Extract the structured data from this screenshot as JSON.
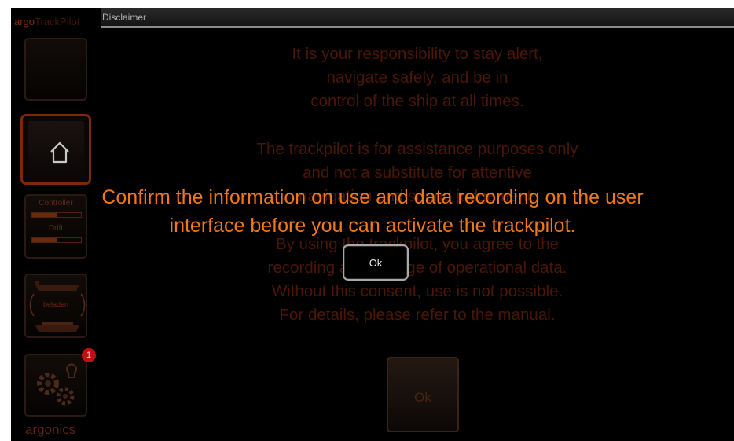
{
  "app": {
    "brand": "argo",
    "product": "TrackPilot",
    "footer_brand": "argonics"
  },
  "sidebar": {
    "controller_label": "Controller",
    "drift_label": "Drift",
    "load_label": "beladen",
    "notifications_count": "1"
  },
  "dialog": {
    "title": "Disclaimer",
    "paragraphs": [
      "It is your responsibility to stay alert,",
      "navigate safely, and be in",
      "control of the ship at all times.",
      "The trackpilot is for assistance purposes only",
      "and not a substitute for attentive",
      "navigation and sound judgement.",
      "By using the trackpilot, you agree to the",
      "recording and storage of operational data.",
      "Without this consent, use is not possible.",
      "For details, please refer to the manual."
    ],
    "ok_label": "Ok"
  },
  "overlay": {
    "message_line1": "Confirm the information on use and data recording on the user",
    "message_line2": "interface before you can activate the trackpilot.",
    "ok_label": "Ok"
  },
  "colors": {
    "accent": "#f07818",
    "dim_text": "#4a1706",
    "home_border": "#7a2a08",
    "badge": "#c01010"
  }
}
